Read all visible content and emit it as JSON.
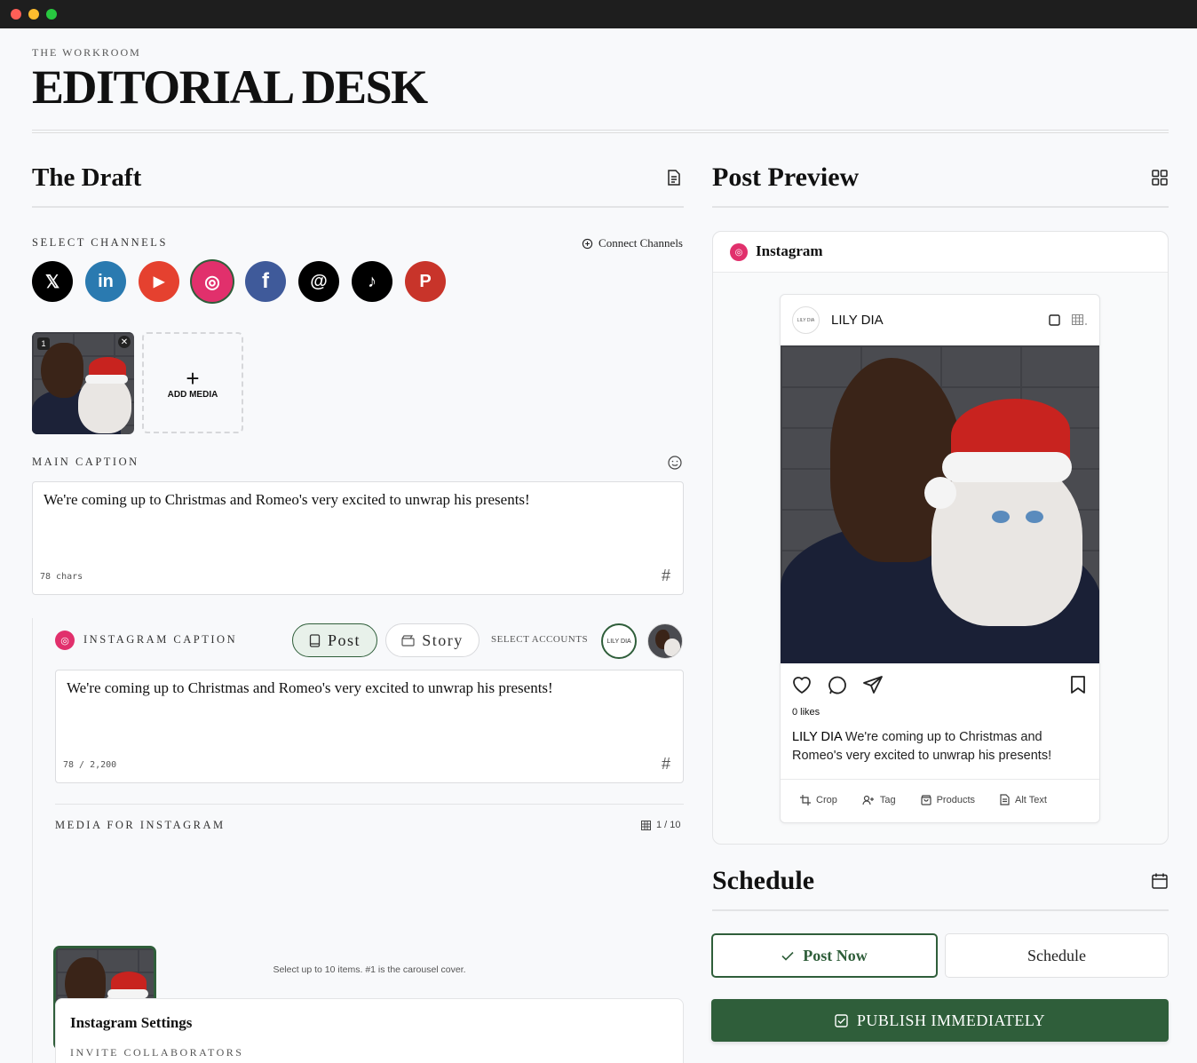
{
  "header": {
    "eyebrow": "THE WORKROOM",
    "title": "EDITORIAL DESK"
  },
  "draft": {
    "title": "The Draft",
    "select_channels_label": "SELECT CHANNELS",
    "connect_label": "Connect Channels",
    "channels": [
      {
        "name": "x",
        "glyph": "𝕏",
        "color": "#000000"
      },
      {
        "name": "linkedin",
        "glyph": "in",
        "color": "#2a7ab0"
      },
      {
        "name": "youtube",
        "glyph": "▶",
        "color": "#e5412f"
      },
      {
        "name": "instagram",
        "glyph": "◎",
        "color": "#e1306c"
      },
      {
        "name": "facebook",
        "glyph": "f",
        "color": "#3f5a9a"
      },
      {
        "name": "threads",
        "glyph": "@",
        "color": "#000000"
      },
      {
        "name": "tiktok",
        "glyph": "♪",
        "color": "#000000"
      },
      {
        "name": "pinterest",
        "glyph": "P",
        "color": "#c8342a"
      }
    ],
    "media_badge": "1",
    "remove_glyph": "✕",
    "add_media_label": "ADD MEDIA",
    "main_caption_label": "MAIN CAPTION",
    "main_caption_text": "We're coming up to Christmas and Romeo's very excited to unwrap his presents!",
    "main_caption_count": "78 chars",
    "hash_glyph": "#"
  },
  "instagram": {
    "caption_label": "INSTAGRAM CAPTION",
    "post_label": "Post",
    "story_label": "Story",
    "select_accounts_label": "SELECT ACCOUNTS",
    "account_name_small": "LILY DIA",
    "caption_text": "We're coming up to Christmas and Romeo's very excited to unwrap his presents!",
    "caption_count": "78 / 2,200",
    "media_label": "MEDIA FOR INSTAGRAM",
    "media_count": "1 / 10",
    "media_hint": "Select up to 10 items. #1 is the carousel cover.",
    "settings_title": "Instagram Settings",
    "collaborators_label": "INVITE COLLABORATORS"
  },
  "preview": {
    "title": "Post Preview",
    "platform": "Instagram",
    "account": "LILY DIA",
    "avatar_text": "LILY DIA",
    "likes": "0 likes",
    "caption_user": "LILY DIA",
    "caption_line1": " We're coming up to Christmas and",
    "caption_line2": "Romeo's very excited to unwrap his presents!",
    "tools": {
      "crop": "Crop",
      "tag": "Tag",
      "products": "Products",
      "alt": "Alt Text"
    }
  },
  "schedule": {
    "title": "Schedule",
    "post_now": "Post Now",
    "schedule": "Schedule",
    "publish": "PUBLISH IMMEDIATELY"
  },
  "colors": {
    "accent": "#2f5e3a",
    "instagram": "#e1306c"
  }
}
